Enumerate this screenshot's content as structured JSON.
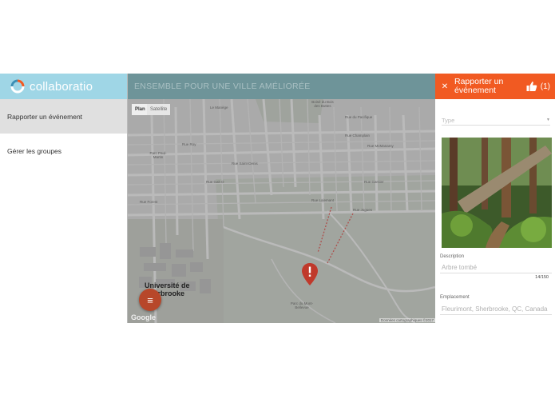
{
  "app": {
    "brand": "collaboratio"
  },
  "sidebar": {
    "items": [
      {
        "label": "Rapporter un événement",
        "active": true
      },
      {
        "label": "Gérer les groupes",
        "active": false
      }
    ]
  },
  "map": {
    "header_title": "ENSEMBLE POUR UNE VILLE AMÉLIORÉE",
    "map_types": {
      "plan": "Plan",
      "satellite": "Satellite"
    },
    "labels": {
      "manege": "Le Manège",
      "bois": "Boisé du Bois des Buttes",
      "pacifique": "Rue du Pacifique",
      "parc_paul_martin": "Parc Paul-Martin",
      "champlain": "Rue Champlain",
      "mcmanamy": "Rue McManamy",
      "roy": "Rue Roy",
      "saint_denis": "Rue Saint-Denis",
      "galt": "Rue Galt O",
      "garnier": "Rue Garnier",
      "lalemant": "Rue Lalemant",
      "jogues": "Rue Jogues",
      "forest": "Rue Forest",
      "parc_mont_bellevue": "Parc du Mont-Bellevue",
      "universite": "Université de Sherbrooke",
      "credit": "Données cartographiques ©2017",
      "google": "Google"
    }
  },
  "panel": {
    "title": "Rapporter un événement",
    "like_count": "(1)",
    "type_placeholder": "Type",
    "description_label": "Description",
    "description_value": "Arbre tombé",
    "char_count": "14/150",
    "location_label": "Emplacement",
    "location_value": "Fleurimont, Sherbrooke, QC, Canada"
  },
  "colors": {
    "brand_bar": "#9fd6e6",
    "map_header": "#6e9499",
    "accent_orange": "#f15a22",
    "fab": "#b7472a",
    "pin": "#c0392b"
  },
  "icons": [
    "logo-icon",
    "close-icon",
    "thumbs-up-icon",
    "menu-icon",
    "map-pin-icon",
    "dropdown-arrow-icon"
  ]
}
